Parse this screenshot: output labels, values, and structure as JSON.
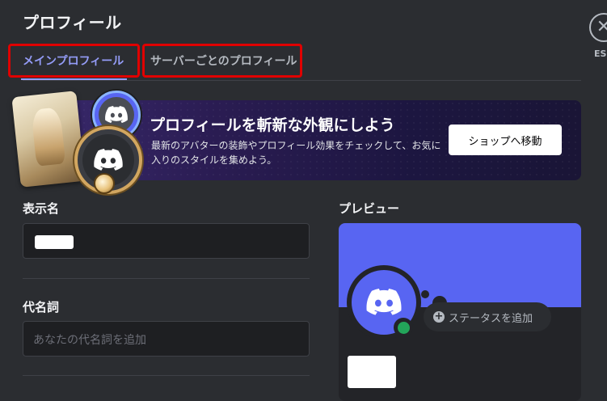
{
  "header": {
    "title": "プロフィール",
    "close_label": "ESC"
  },
  "tabs": [
    {
      "label": "メインプロフィール",
      "active": true
    },
    {
      "label": "サーバーごとのプロフィール",
      "active": false
    }
  ],
  "banner": {
    "title": "プロフィールを斬新な外観にしよう",
    "description": "最新のアバターの装飾やプロフィール効果をチェックして、お気に入りのスタイルを集めよう。",
    "button_label": "ショップへ移動"
  },
  "form": {
    "display_name_label": "表示名",
    "display_name_value": "",
    "pronouns_label": "代名詞",
    "pronouns_placeholder": "あなたの代名詞を追加"
  },
  "preview": {
    "label": "プレビュー",
    "status_button": "ステータスを追加",
    "username": ""
  },
  "colors": {
    "background": "#2b2d31",
    "accent": "#5865f2",
    "tab_active": "#949cf7",
    "highlight_border": "#e00000",
    "online": "#23a55a"
  }
}
